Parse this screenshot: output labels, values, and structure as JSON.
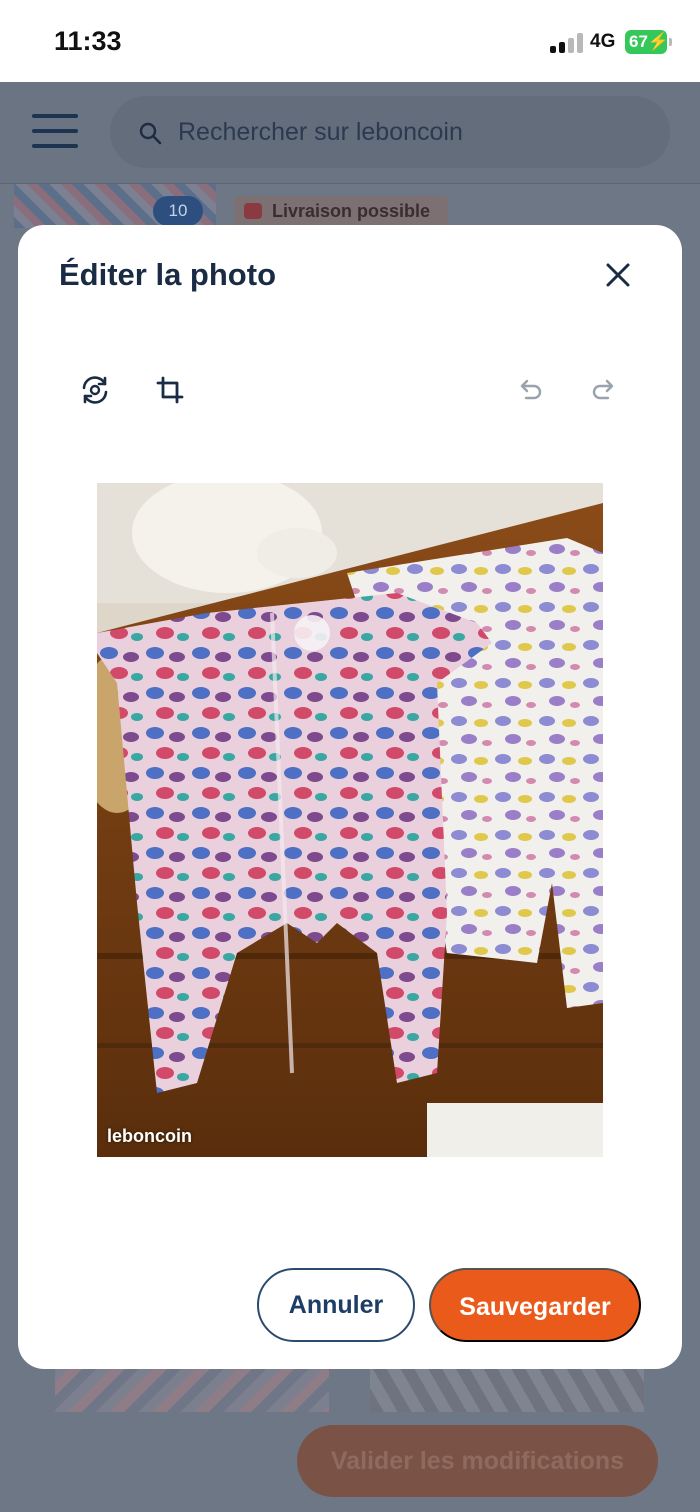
{
  "status_bar": {
    "time": "11:33",
    "network": "4G",
    "battery": "67"
  },
  "background": {
    "search_placeholder": "Rechercher sur leboncoin",
    "thumb_count": "10",
    "delivery_badge": "Livraison possible",
    "validate_button": "Valider les modifications"
  },
  "modal": {
    "title": "Éditer la photo",
    "watermark": "leboncoin",
    "cancel_label": "Annuler",
    "save_label": "Sauvegarder"
  },
  "colors": {
    "accent": "#ea5b1b",
    "navy": "#1a2b44",
    "overlay": "#6e7785",
    "battery": "#34c759"
  },
  "icons": [
    "menu-icon",
    "search-icon",
    "rotate-icon",
    "crop-icon",
    "undo-icon",
    "redo-icon",
    "close-icon"
  ]
}
